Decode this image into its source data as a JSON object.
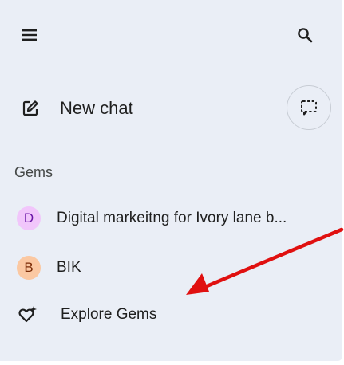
{
  "header": {
    "menu_icon": "hamburger-menu-icon",
    "search_icon": "search-icon"
  },
  "new_chat": {
    "label": "New chat",
    "icon": "edit-square-icon"
  },
  "temporary_chat": {
    "icon": "dashed-chat-bubble-icon"
  },
  "gems": {
    "title": "Gems",
    "items": [
      {
        "initial": "D",
        "label": "Digital markeitng for Ivory lane b...",
        "avatar_bg": "#f1c6fb",
        "avatar_fg": "#6b16a8"
      },
      {
        "initial": "B",
        "label": "BIK",
        "avatar_bg": "#fbc8a2",
        "avatar_fg": "#7a2a05"
      }
    ],
    "explore": {
      "label": "Explore Gems",
      "icon": "heart-sparkle-icon"
    }
  },
  "colors": {
    "panel_bg": "#eaeef6",
    "text": "#1f1f1f",
    "annotation_arrow": "#e01010"
  }
}
